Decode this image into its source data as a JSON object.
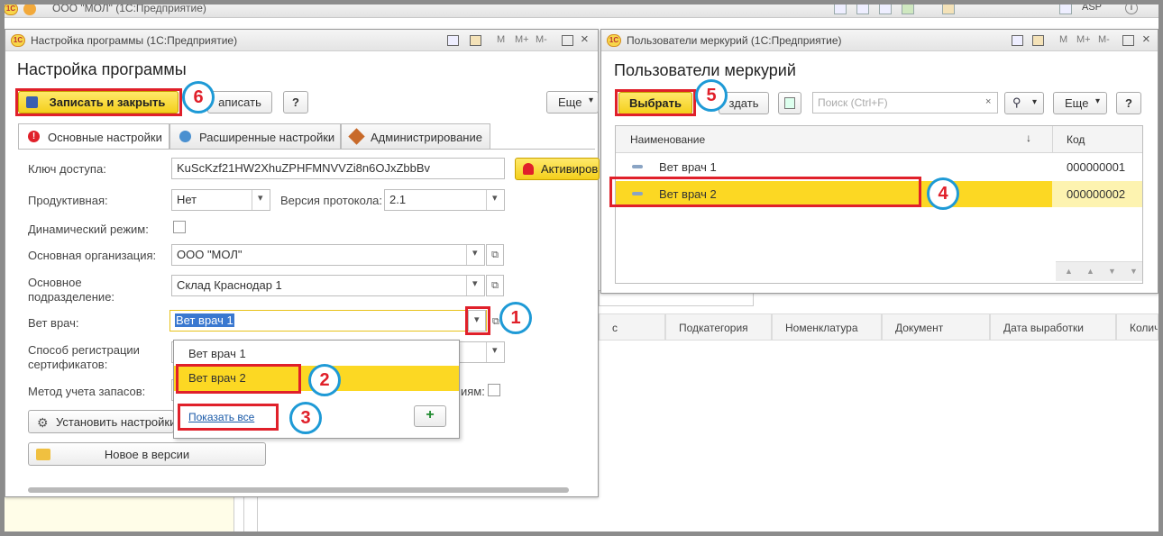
{
  "app": {
    "title": "ООО \"МОЛ\" (1С:Предприятие)",
    "user": "ASP"
  },
  "bg_table": {
    "headers": [
      "с",
      "Подкатегория",
      "Номенклатура",
      "Документ",
      "Дата выработки",
      "Колич"
    ]
  },
  "settings_window": {
    "window_title": "Настройка программы (1С:Предприятие)",
    "heading": "Настройка программы",
    "btn_save_close": "Записать и закрыть",
    "btn_save": "аписать",
    "btn_help": "?",
    "btn_more": "Еще",
    "tabs": [
      "Основные настройки",
      "Расширенные настройки",
      "Администрирование"
    ],
    "labels": {
      "access_key": "Ключ доступа:",
      "productive": "Продуктивная:",
      "protocol": "Версия протокола:",
      "dynamic": "Динамический режим:",
      "org": "Основная организация:",
      "subdivision_1": "Основное",
      "subdivision_2": "подразделение:",
      "vet": "Вет врач:",
      "reg_1": "Способ регистрации",
      "reg_2": "сертификатов:",
      "stock": "Метод учета запасов:",
      "partial": "иям:"
    },
    "values": {
      "access_key": "KuScKzf21HW2XhuZPHFMNVVZi8n6OJxZbbBv",
      "productive": "Нет",
      "protocol": "2.1",
      "org": "ООО \"МОЛ\"",
      "subdivision": "Склад Краснодар 1",
      "vet": "Вет врач 1"
    },
    "btn_activate": "Активиров",
    "btn_install": "Установить настройки",
    "btn_new": "Новое в версии",
    "dropdown": {
      "items": [
        "Вет врач 1",
        "Вет врач 2"
      ],
      "show_all": "Показать все",
      "add": "+"
    }
  },
  "users_window": {
    "window_title": "Пользователи меркурий (1С:Предприятие)",
    "heading": "Пользователи меркурий",
    "btn_select": "Выбрать",
    "btn_create": "здать",
    "search_placeholder": "Поиск (Ctrl+F)",
    "btn_more": "Еще",
    "btn_help": "?",
    "columns": {
      "name": "Наименование",
      "sort": "↓",
      "code": "Код"
    },
    "rows": [
      {
        "name": "Вет врач 1",
        "code": "000000001"
      },
      {
        "name": "Вет врач 2",
        "code": "000000002"
      }
    ]
  },
  "badges": [
    "1",
    "2",
    "3",
    "4",
    "5",
    "6"
  ],
  "colors": {
    "accent_yellow": "#f4cf1b",
    "highlight_red": "#e0202a",
    "badge_blue": "#1e9ad6"
  }
}
